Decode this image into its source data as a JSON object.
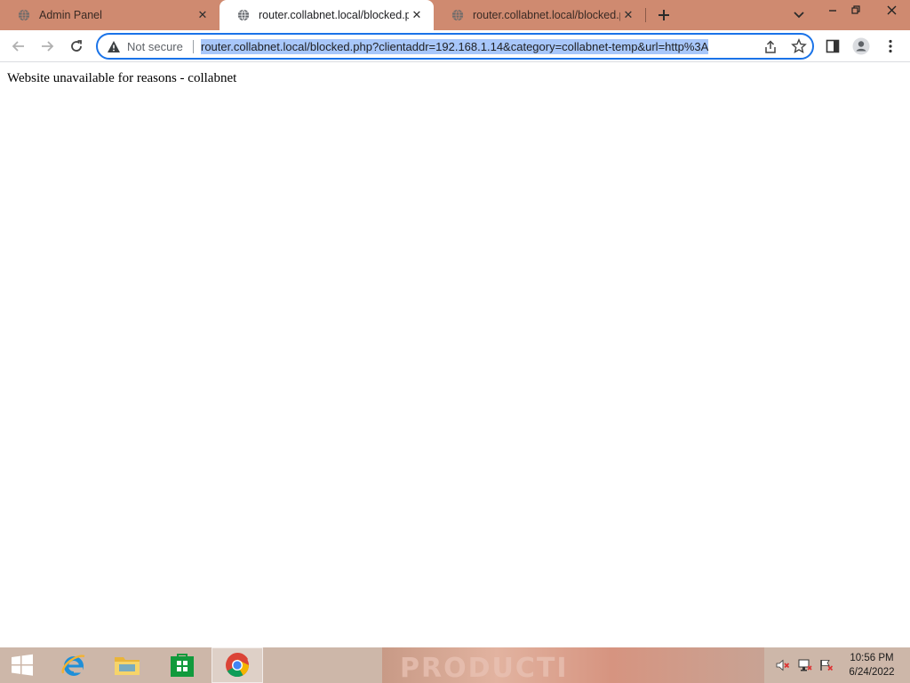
{
  "browser": {
    "tabs": [
      {
        "title": "Admin Panel",
        "active": false
      },
      {
        "title": "router.collabnet.local/blocked.php",
        "active": true
      },
      {
        "title": "router.collabnet.local/blocked.php",
        "active": false
      }
    ],
    "new_tab_icon": "plus-icon",
    "tab_search_icon": "chevron-down-icon",
    "window_controls": [
      "minimize-icon",
      "restore-icon",
      "close-icon"
    ]
  },
  "toolbar": {
    "security_label": "Not secure",
    "url": "router.collabnet.local/blocked.php?clientaddr=192.168.1.14&category=collabnet-temp&url=http%3A",
    "accent_color": "#1a73e8",
    "selection_color": "#a8c7fa"
  },
  "page": {
    "message": "Website unavailable for reasons - collabnet"
  },
  "taskbar": {
    "apps": [
      "windows-start",
      "internet-explorer",
      "file-explorer",
      "windows-store",
      "google-chrome"
    ],
    "active_app": "google-chrome",
    "wallpaper_text": "PRODUCTI",
    "clock": {
      "time": "10:56 PM",
      "date": "6/24/2022"
    }
  },
  "colors": {
    "tabstrip": "#cf8a70",
    "taskbar": "#cdb7a9"
  }
}
